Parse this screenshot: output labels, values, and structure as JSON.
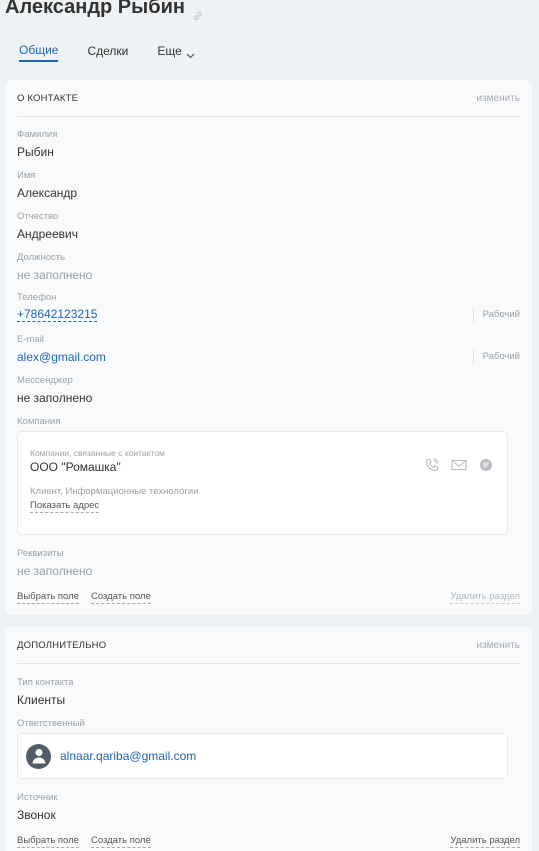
{
  "header": {
    "title": "Александр Рыбин",
    "icon": "link-icon"
  },
  "tabs": [
    {
      "label": "Общие",
      "active": true
    },
    {
      "label": "Сделки",
      "active": false
    },
    {
      "label": "Еще",
      "active": false,
      "icon": "chevron-down-icon"
    }
  ],
  "contact_section": {
    "title": "О КОНТАКТЕ",
    "edit_label": "изменить",
    "fields": {
      "last_name": {
        "label": "Фамилия",
        "value": "Рыбин"
      },
      "first_name": {
        "label": "Имя",
        "value": "Александр"
      },
      "patronymic": {
        "label": "Отчество",
        "value": "Андреевич"
      },
      "position": {
        "label": "Должность",
        "value": "не заполнено"
      },
      "phone": {
        "label": "Телефон",
        "value": "+78642123215",
        "type": "Рабочий"
      },
      "email": {
        "label": "E-mail",
        "value": "alex@gmail.com",
        "type": "Рабочий"
      },
      "messenger": {
        "label": "Мессенджер",
        "value": "не заполнено"
      },
      "company": {
        "label": "Компания"
      },
      "requisites": {
        "label": "Реквизиты",
        "value": "не заполнено"
      }
    },
    "company_card": {
      "subtitle": "Компании, связанные с контактом",
      "name": "ООО \"Ромашка\"",
      "tags": "Клиент, Информационные технологии",
      "address_link": "Показать адрес",
      "icons": [
        "phone-icon",
        "mail-icon",
        "chat-icon"
      ]
    },
    "actions": {
      "choose_field": "Выбрать поле",
      "create_field": "Создать поле",
      "delete_section": "Удалить раздел"
    }
  },
  "extra_section": {
    "title": "ДОПОЛНИТЕЛЬНО",
    "edit_label": "изменить",
    "fields": {
      "contact_type": {
        "label": "Тип контакта",
        "value": "Клиенты"
      },
      "responsible": {
        "label": "Ответственный",
        "value": "alnaar.qariba@gmail.com"
      },
      "source": {
        "label": "Источник",
        "value": "Звонок"
      }
    },
    "actions": {
      "choose_field": "Выбрать поле",
      "create_field": "Создать поле",
      "delete_section": "Удалить раздел"
    }
  },
  "colors": {
    "accent": "#2067b0",
    "muted": "#9ba1a6",
    "background": "#eef2f4"
  }
}
